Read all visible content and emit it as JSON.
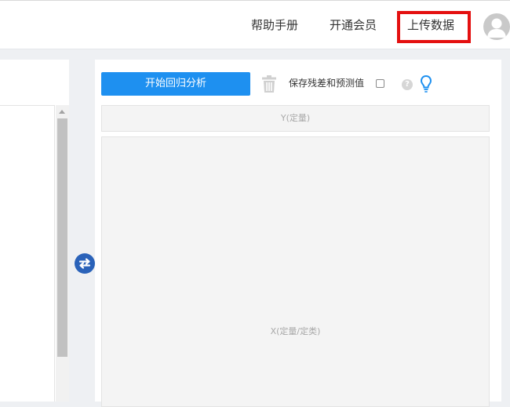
{
  "header": {
    "help_label": "帮助手册",
    "vip_label": "开通会员",
    "upload_label": "上传数据",
    "avatar_icon": "user-avatar-icon",
    "upload_highlight_color": "#e41010"
  },
  "toolbar": {
    "start_label": "开始回归分析",
    "start_color": "#1e90f0",
    "delete_icon": "trash-icon",
    "save_residual_label": "保存残差和预测值",
    "save_residual_checked": false,
    "help_icon": "question-icon",
    "tip_icon": "lightbulb-icon"
  },
  "swap": {
    "icon": "swap-arrows-icon",
    "color": "#2a62b9"
  },
  "fields": {
    "y_label": "Y(定量)",
    "x_label": "X(定量/定类)"
  }
}
